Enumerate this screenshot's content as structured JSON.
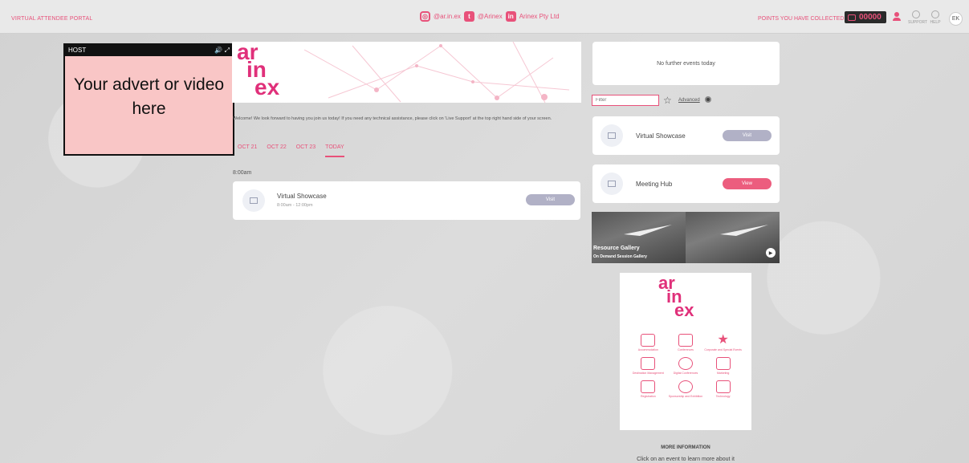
{
  "topbar": {
    "brand": "VIRTUAL ATTENDEE PORTAL",
    "social": [
      {
        "icon": "instagram-icon",
        "label": "@ar.in.ex"
      },
      {
        "icon": "twitter-icon",
        "label": "@Arinex"
      },
      {
        "icon": "linkedin-icon",
        "label": "Arinex Pty Ltd"
      }
    ],
    "points_label": "POINTS YOU HAVE COLLECTED!",
    "points_value": "00000",
    "support_label": "SUPPORT",
    "help_label": "HELP",
    "avatar_initials": "EK"
  },
  "host": {
    "label": "HOST",
    "volume_icon": "volume-icon",
    "expand_icon": "expand-icon",
    "placeholder": "Your advert or video here"
  },
  "main": {
    "logo": {
      "line1": "ar",
      "line2": "in",
      "line3": "ex"
    },
    "welcome": "Welcome! We look forward to having you join us today! If you need any technical assistance, please click on 'Live Support' at the top right hand side of your screen.",
    "tabs": [
      {
        "label": "OCT 21"
      },
      {
        "label": "OCT 22"
      },
      {
        "label": "OCT 23"
      },
      {
        "label": "TODAY"
      }
    ],
    "time_label": "8:00am",
    "event": {
      "title": "Virtual Showcase",
      "time": "8:00am - 12:00pm",
      "button": "Visit"
    }
  },
  "sidebar": {
    "no_events": "No further events today",
    "filter_placeholder": "Filter",
    "advanced": "Advanced",
    "cards": [
      {
        "title": "Virtual Showcase",
        "button": "Visit"
      },
      {
        "title": "Meeting Hub",
        "button": "View"
      }
    ],
    "gallery": {
      "title": "Resource Gallery",
      "subtitle": "On Demand Session Gallery"
    },
    "promo": {
      "logo": {
        "line1": "ar",
        "line2": "in",
        "line3": "ex"
      },
      "items": [
        {
          "label": "Accommodation",
          "icon": "building-icon"
        },
        {
          "label": "Conferences",
          "icon": "folder-icon"
        },
        {
          "label": "Corporate and Special Events",
          "icon": "star-icon"
        },
        {
          "label": "Destination Management",
          "icon": "location-icon"
        },
        {
          "label": "Digital Conferences",
          "icon": "globe-icon"
        },
        {
          "label": "Marketing",
          "icon": "mail-icon"
        },
        {
          "label": "Registration",
          "icon": "people-icon"
        },
        {
          "label": "Sponsorship and Exhibition",
          "icon": "dollar-icon"
        },
        {
          "label": "Technology",
          "icon": "chip-icon"
        }
      ]
    },
    "more_info_title": "MORE INFORMATION",
    "more_info_text": "Click on an event to learn more about it"
  },
  "colors": {
    "accent": "#e8517a",
    "logo": "#e0307a",
    "visit_button": "#b1b1c6",
    "view_button": "#ec5d7e",
    "host_placeholder_bg": "#f9c6c6"
  }
}
